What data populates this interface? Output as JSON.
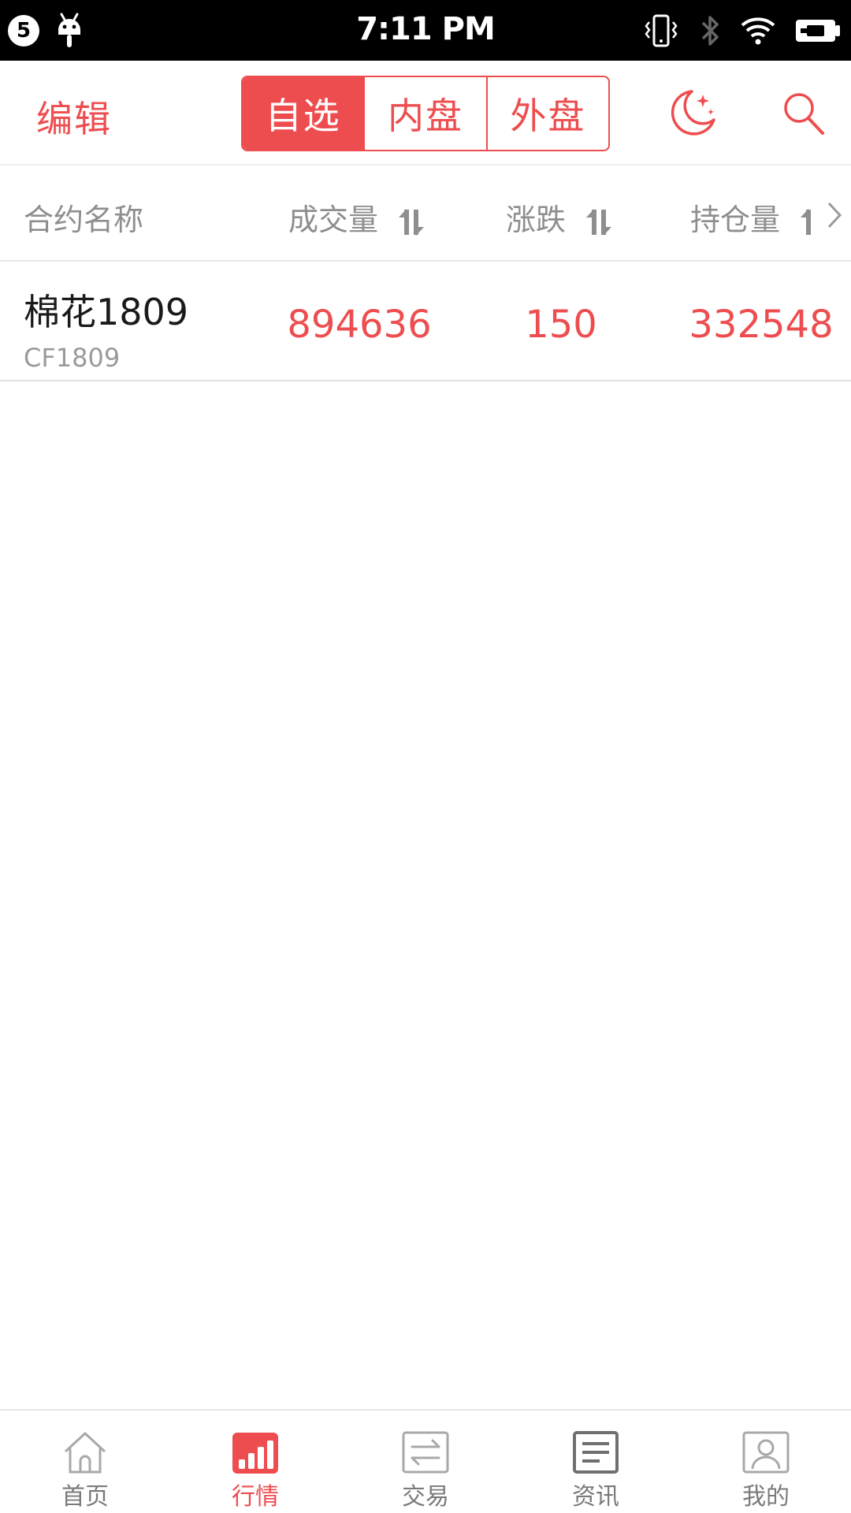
{
  "status_bar": {
    "badge": "5",
    "time": "7:11 PM"
  },
  "topbar": {
    "edit_label": "编辑",
    "segments": [
      "自选",
      "内盘",
      "外盘"
    ],
    "active_segment": 0
  },
  "table": {
    "headers": [
      "合约名称",
      "成交量",
      "涨跌",
      "持仓量"
    ],
    "rows": [
      {
        "name": "棉花1809",
        "code": "CF1809",
        "volume": "894636",
        "change": "150",
        "open_interest": "332548"
      }
    ]
  },
  "bottom_nav": {
    "items": [
      "首页",
      "行情",
      "交易",
      "资讯",
      "我的"
    ],
    "active": 1
  },
  "colors": {
    "accent": "#ee4d4f",
    "muted": "#8e8e8e"
  }
}
